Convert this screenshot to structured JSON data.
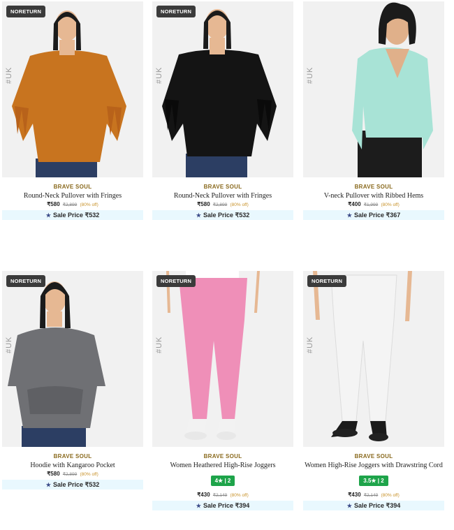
{
  "products": [
    {
      "badge": "NORETURN",
      "tag": "#UK",
      "brand": "BRAVE SOUL",
      "title": "Round-Neck Pullover with Fringes",
      "price": "₹580",
      "mrp": "₹2,899",
      "off": "(80% off)",
      "rating": "",
      "sale_label": "Sale Price ₹532",
      "garment_color": "#c8741f",
      "legs_color": "#2c3e63",
      "skin": "#e6b893",
      "hair": "#1b1b1b"
    },
    {
      "badge": "NORETURN",
      "tag": "#UK",
      "brand": "BRAVE SOUL",
      "title": "Round-Neck Pullover with Fringes",
      "price": "₹580",
      "mrp": "₹2,899",
      "off": "(80% off)",
      "rating": "",
      "sale_label": "Sale Price ₹532",
      "garment_color": "#141414",
      "legs_color": "#2c3e63",
      "skin": "#e6b893",
      "hair": "#1b1b1b"
    },
    {
      "badge": "",
      "tag": "#UK",
      "brand": "BRAVE SOUL",
      "title": "V-neck Pullover with Ribbed Hems",
      "price": "₹400",
      "mrp": "₹1,999",
      "off": "(80% off)",
      "rating": "",
      "sale_label": "Sale Price ₹367",
      "garment_color": "#a8e3d6",
      "legs_color": "#1c1c1c",
      "skin": "#e0b08a",
      "hair": "#1b1b1b"
    },
    {
      "badge": "NORETURN",
      "tag": "#UK",
      "brand": "BRAVE SOUL",
      "title": "Hoodie with Kangaroo Pocket",
      "price": "₹580",
      "mrp": "₹2,899",
      "off": "(80% off)",
      "rating": "",
      "sale_label": "Sale Price ₹532",
      "garment_color": "#6f7074",
      "legs_color": "#2c3e63",
      "skin": "#e6b893",
      "hair": "#1b1b1b"
    },
    {
      "badge": "NORETURN",
      "tag": "#UK",
      "brand": "BRAVE SOUL",
      "title": "Women Heathered High-Rise Joggers",
      "price": "₹430",
      "mrp": "₹2,149",
      "off": "(80% off)",
      "rating": "4★ | 2",
      "sale_label": "Sale Price ₹394",
      "garment_color": "#ef8fb8",
      "legs_color": "#ef8fb8",
      "skin": "#e6b893",
      "hair": "#1b1b1b"
    },
    {
      "badge": "NORETURN",
      "tag": "#UK",
      "brand": "BRAVE SOUL",
      "title": "Women High-Rise Joggers with Drawstring Cord",
      "price": "₹430",
      "mrp": "₹2,149",
      "off": "(80% off)",
      "rating": "3.5★ | 2",
      "sale_label": "Sale Price ₹394",
      "garment_color": "#f4f4f4",
      "legs_color": "#f4f4f4",
      "skin": "#e6b893",
      "hair": "#1b1b1b"
    }
  ]
}
